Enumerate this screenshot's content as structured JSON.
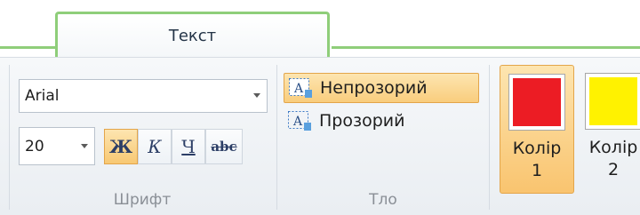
{
  "tabs": [
    {
      "label": "Текст",
      "active": true
    }
  ],
  "font_group": {
    "label": "Шрифт",
    "font_name": "Arial",
    "font_size": "20",
    "styles": {
      "bold": {
        "glyph": "Ж",
        "active": true
      },
      "italic": {
        "glyph": "К",
        "active": false
      },
      "underline": {
        "glyph": "Ч",
        "active": false
      },
      "strikethrough": {
        "glyph": "abc",
        "active": false
      }
    }
  },
  "background_group": {
    "label": "Тло",
    "options": [
      {
        "label": "Непрозорий",
        "icon": "opaque-text-icon",
        "active": true
      },
      {
        "label": "Прозорий",
        "icon": "transparent-text-icon",
        "active": false
      }
    ]
  },
  "colors": [
    {
      "label_line1": "Колір",
      "label_line2": "1",
      "swatch": "#ec1c24",
      "active": true
    },
    {
      "label_line1": "Колір",
      "label_line2": "2",
      "swatch": "#fff200",
      "active": false
    }
  ],
  "theme": {
    "tab_accent": "#8fce7a",
    "active_highlight": "#f9c46f",
    "active_border": "#e3a54a"
  }
}
